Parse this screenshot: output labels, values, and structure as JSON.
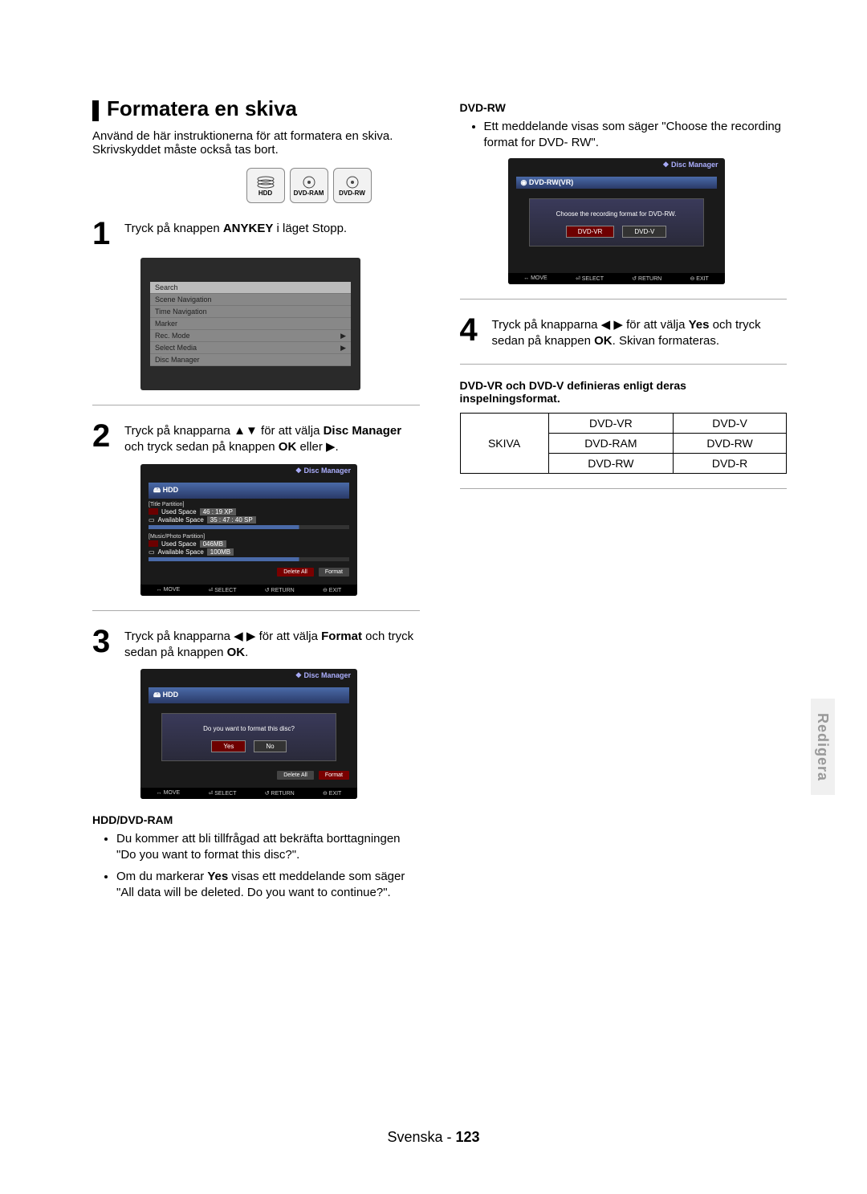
{
  "side_tab": "Redigera",
  "title": "Formatera en skiva",
  "intro": "Använd de här instruktionerna för att formatera en skiva. Skrivskyddet måste också tas bort.",
  "media_icons": [
    "HDD",
    "DVD-RAM",
    "DVD-RW"
  ],
  "step1": {
    "num": "1",
    "text_pre": "Tryck på knappen ",
    "text_bold": "ANYKEY",
    "text_post": " i läget Stopp.",
    "menu": [
      "Search",
      "Scene Navigation",
      "Time Navigation",
      "Marker",
      "Rec. Mode",
      "Select Media",
      "Disc Manager"
    ],
    "arrow_rows": [
      4,
      5
    ]
  },
  "step2": {
    "num": "2",
    "parts": [
      "Tryck på knapparna ▲▼ för att välja ",
      "Disc Manager",
      " och tryck sedan på knappen ",
      "OK",
      " eller ▶."
    ],
    "panel": {
      "header": "Disc Manager",
      "hdd": "HDD",
      "title_part": "[Title Partition]",
      "used_label": "Used Space",
      "used_val": "46 : 19 XP",
      "avail_label": "Available Space",
      "avail_val": "35 : 47 : 40 SP",
      "mp_part": "[Music/Photo Partition]",
      "mp_used": "046MB",
      "mp_avail": "100MB",
      "btn_del": "Delete All",
      "btn_fmt": "Format",
      "footer": [
        "↔ MOVE",
        "⏎ SELECT",
        "↺ RETURN",
        "⊖ EXIT"
      ]
    }
  },
  "step3": {
    "num": "3",
    "parts": [
      "Tryck på knapparna ◀ ▶ för att välja ",
      "Format",
      " och tryck sedan på knappen ",
      "OK",
      "."
    ],
    "panel": {
      "header": "Disc Manager",
      "hdd": "HDD",
      "question": "Do you want to format this disc?",
      "yes": "Yes",
      "no": "No",
      "footer": [
        "↔ MOVE",
        "⏎ SELECT",
        "↺ RETURN",
        "⊖ EXIT"
      ]
    }
  },
  "hdd_section": {
    "heading": "HDD/DVD-RAM",
    "b1": "Du kommer att bli tillfrågad att bekräfta borttagningen \"Do you want to format this disc?\".",
    "b2_pre": "Om du markerar ",
    "b2_bold": "Yes",
    "b2_post": " visas ett meddelande som säger \"All data will be deleted. Do you want to continue?\"."
  },
  "dvdrw_section": {
    "heading": "DVD-RW",
    "bullet": "Ett meddelande visas som säger \"Choose the recording format for DVD- RW\".",
    "panel": {
      "header": "Disc Manager",
      "disc": "DVD-RW(VR)",
      "question": "Choose the recording format for DVD-RW.",
      "btn1": "DVD-VR",
      "btn2": "DVD-V",
      "footer": [
        "↔ MOVE",
        "⏎ SELECT",
        "↺ RETURN",
        "⊖ EXIT"
      ]
    }
  },
  "step4": {
    "num": "4",
    "parts": [
      "Tryck på knapparna ◀ ▶ för att välja ",
      "Yes",
      " och tryck sedan på knappen ",
      "OK",
      ". Skivan formateras."
    ]
  },
  "definition_line": "DVD-VR och DVD-V definieras enligt deras inspelningsformat.",
  "table": {
    "row_label": "SKIVA",
    "c1": "DVD-VR",
    "c2": "DVD-V",
    "r1a": "DVD-RAM",
    "r1b": "DVD-RW",
    "r2a": "DVD-RW",
    "r2b": "DVD-R"
  },
  "footer": {
    "lang": "Svenska",
    "sep": " - ",
    "page": "123"
  }
}
